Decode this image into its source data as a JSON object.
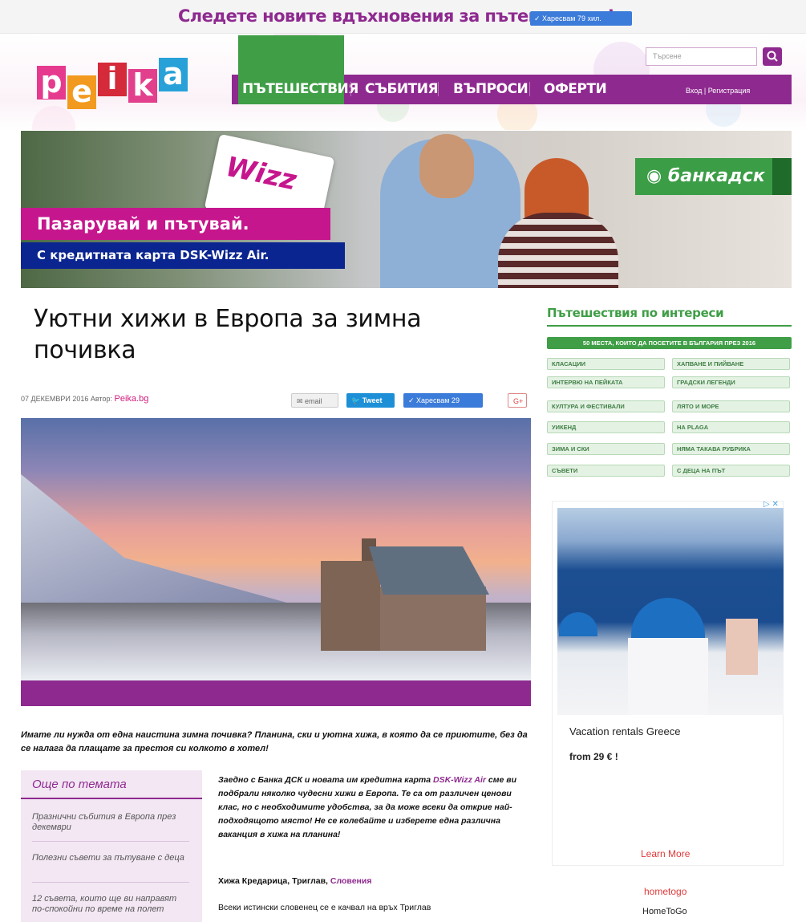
{
  "promo": {
    "text": "Следете новите вдъхновения за пътешествия!",
    "like_label": "✓ Харесвам 79 хил."
  },
  "header": {
    "logo_letters": [
      "p",
      "e",
      "i",
      "k",
      "a"
    ],
    "nav": [
      "ПЪТЕШЕСТВИЯ",
      "СЪБИТИЯ",
      "ВЪПРОСИ",
      "ОФЕРТИ"
    ],
    "login": "Вход | Регистрация",
    "search_placeholder": "Търсене"
  },
  "banner": {
    "card_text": "Wizz",
    "headline": "Пазарувай и пътувай.",
    "subline": "С кредитната карта DSK-Wizz Air.",
    "bank": "банкадск"
  },
  "article": {
    "title": "Уютни хижи в Европа за зимна почивка",
    "date": "07 ДЕКЕМВРИ 2016",
    "author_label": "Автор:",
    "author": "Peika.bg",
    "share_email": "✉ email",
    "share_tweet": "Tweet",
    "share_like": "✓ Харесвам 29",
    "share_plus": "G+",
    "lead": "Имате ли нужда от една наистина зимна почивка? Планина, ски и уютна хижа, в която да се приютите, без да се налага да плащате за престоя си колкото в хотел!",
    "para1_prefix": "Заедно с Банка ДСК и новата им кредитна карта ",
    "para1_link": "DSK-Wizz Air",
    "para1_suffix": " сме ви подбрали няколко чудесни хижи в Европа. Те са от различен ценови клас, но с необходимите удобства, за да може всеки да открие най-подходящото място! Не се колебайте и изберете една различна ваканция в хижа на планина!",
    "sub_heading": "Хижа Кредарица, Триглав, ",
    "sub_link": "Словения",
    "para2": "Всеки истински словенец се е качвал на връх Триглав"
  },
  "related": {
    "title": "Още по темата",
    "items": [
      "Празнични събития в Европа през декември",
      "Полезни съвети за пътуване с деца",
      "12 съвета, които ще ви направят по-спокойни по време на полет"
    ]
  },
  "sidebar": {
    "title": "Пътешествия по интереси",
    "top_tag": "50 МЕСТА, КОИТО ДА ПОСЕТИТЕ В БЪЛГАРИЯ ПРЕЗ 2016",
    "tags": [
      "КЛАСАЦИИ",
      "ХАПВАНЕ И ПИЙВАНЕ",
      "ИНТЕРВЮ НА ПЕЙКАТА",
      "ГРАДСКИ ЛЕГЕНДИ",
      "КУЛТУРА И ФЕСТИВАЛИ",
      "ЛЯТО И МОРЕ",
      "УИКЕНД",
      "НА PLAGA",
      "ЗИМА И СКИ",
      "НЯМА ТАКАВА РУБРИКА",
      "СЪВЕТИ",
      "С ДЕЦА НА ПЪТ"
    ]
  },
  "ad": {
    "close": "▷ ✕",
    "title": "Vacation rentals Greece",
    "price": "from 29 € !",
    "cta": "Learn More",
    "brand": "hometogo",
    "brand_name": "HomeToGo"
  },
  "colors": {
    "brand_purple": "#8e2a8f",
    "brand_green": "#3f9e46",
    "accent_red": "#d01c7d"
  }
}
